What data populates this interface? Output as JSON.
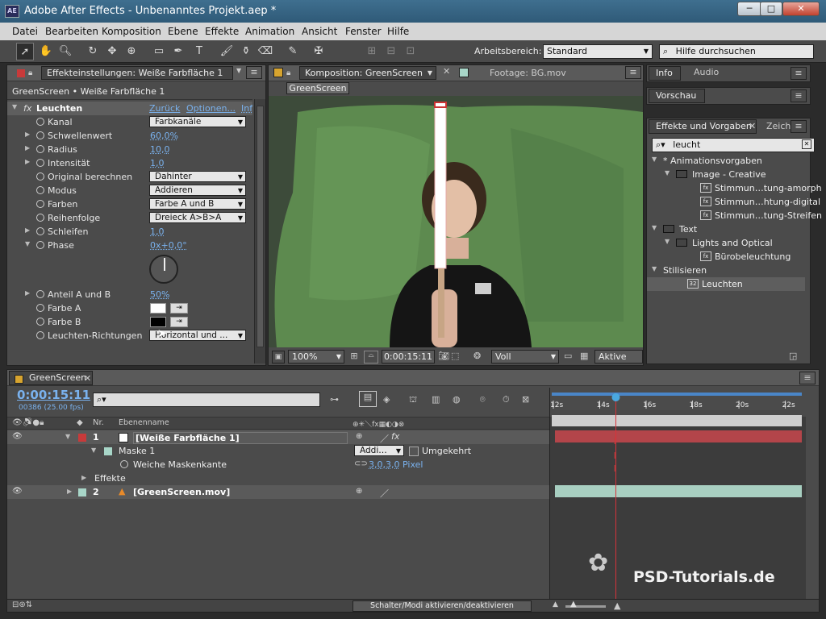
{
  "window": {
    "title": "Adobe After Effects - Unbenanntes Projekt.aep *",
    "logo": "AE",
    "minimize": "─",
    "maximize": "□",
    "close": "✕"
  },
  "menu": [
    "Datei",
    "Bearbeiten",
    "Komposition",
    "Ebene",
    "Effekte",
    "Animation",
    "Ansicht",
    "Fenster",
    "Hilfe"
  ],
  "toolbar": {
    "workspace_label": "Arbeitsbereich:",
    "workspace_value": "Standard",
    "search_placeholder": "Hilfe durchsuchen"
  },
  "effect_panel": {
    "tab": "Effekteinstellungen: Weiße Farbfläche 1",
    "breadcrumb": "GreenScreen • Weiße Farbfläche 1",
    "effect_name": "Leuchten",
    "reset_link": "Zurück",
    "options_link": "Optionen...",
    "info_link": "Inf",
    "phase_dial": "◴",
    "properties": [
      {
        "label": "Kanal",
        "type": "dropdown",
        "value": "Farbkanäle"
      },
      {
        "label": "Schwellenwert",
        "type": "value",
        "value": "60,0%"
      },
      {
        "label": "Radius",
        "type": "value",
        "value": "10,0"
      },
      {
        "label": "Intensität",
        "type": "value",
        "value": "1,0"
      },
      {
        "label": "Original berechnen",
        "type": "dropdown",
        "value": "Dahinter"
      },
      {
        "label": "Modus",
        "type": "dropdown",
        "value": "Addieren"
      },
      {
        "label": "Farben",
        "type": "dropdown",
        "value": "Farbe A und B"
      },
      {
        "label": "Reihenfolge",
        "type": "dropdown",
        "value": "Dreieck A>B>A"
      },
      {
        "label": "Schleifen",
        "type": "value",
        "value": "1,0"
      },
      {
        "label": "Phase",
        "type": "value",
        "value": "0x+0,0°"
      },
      {
        "label": "Anteil A und B",
        "type": "value",
        "value": "50%"
      },
      {
        "label": "Farbe A",
        "type": "color",
        "value": "#ffffff"
      },
      {
        "label": "Farbe B",
        "type": "color",
        "value": "#000000"
      },
      {
        "label": "Leuchten-Richtungen",
        "type": "dropdown",
        "value": "Horizontal und ..."
      }
    ]
  },
  "comp_panel": {
    "tab": "Komposition: GreenScreen",
    "footage_tab": "Footage: BG.mov",
    "comp_button": "GreenScreen",
    "zoom": "100%",
    "timecode": "0:00:15:11",
    "resolution": "Voll",
    "camera": "Aktive Kar"
  },
  "right_panels": {
    "info_tab": "Info",
    "audio_tab": "Audio",
    "preview_tab": "Vorschau",
    "effects_tab": "Effekte und Vorgaben",
    "char_tab": "Zeich",
    "search_value": "leucht",
    "tree": [
      {
        "label": "* Animationsvorgaben",
        "level": 0,
        "kind": "open"
      },
      {
        "label": "Image - Creative",
        "level": 1,
        "kind": "folder"
      },
      {
        "label": "Stimmun…tung-amorph",
        "level": 2,
        "kind": "preset"
      },
      {
        "label": "Stimmun…htung-digital",
        "level": 2,
        "kind": "preset"
      },
      {
        "label": "Stimmun…tung-Streifen",
        "level": 2,
        "kind": "preset"
      },
      {
        "label": "Text",
        "level": 0,
        "kind": "folder"
      },
      {
        "label": "Lights and Optical",
        "level": 1,
        "kind": "folder"
      },
      {
        "label": "Bürobeleuchtung",
        "level": 2,
        "kind": "preset"
      },
      {
        "label": "Stilisieren",
        "level": 0,
        "kind": "open"
      },
      {
        "label": "Leuchten",
        "level": 1,
        "kind": "effect"
      }
    ]
  },
  "timeline": {
    "tab": "GreenScreen",
    "timecode": "0:00:15:11",
    "frame_info": "00386 (25.00 fps)",
    "col_nr": "Nr.",
    "col_name": "Ebenenname",
    "ruler": [
      "12s",
      "14s",
      "16s",
      "18s",
      "20s",
      "22s"
    ],
    "playhead_fraction": 0.26,
    "layers": [
      {
        "nr": "1",
        "name": "[Weiße Farbfläche 1]",
        "color": "#c83a3a",
        "kind": "solid"
      },
      {
        "nr": "2",
        "name": "[GreenScreen.mov]",
        "color": "#a8d6c8",
        "kind": "footage"
      }
    ],
    "mask_name": "Maske 1",
    "mask_mode": "Addi…",
    "mask_invert": "Umgekehrt",
    "feather_label": "Weiche Maskenkante",
    "feather_value": "3,0,3,0",
    "feather_unit": "Pixel",
    "effects_label": "Effekte",
    "toggle_button": "Schalter/Modi aktivieren/deaktivieren"
  },
  "watermark": "PSD-Tutorials.de"
}
